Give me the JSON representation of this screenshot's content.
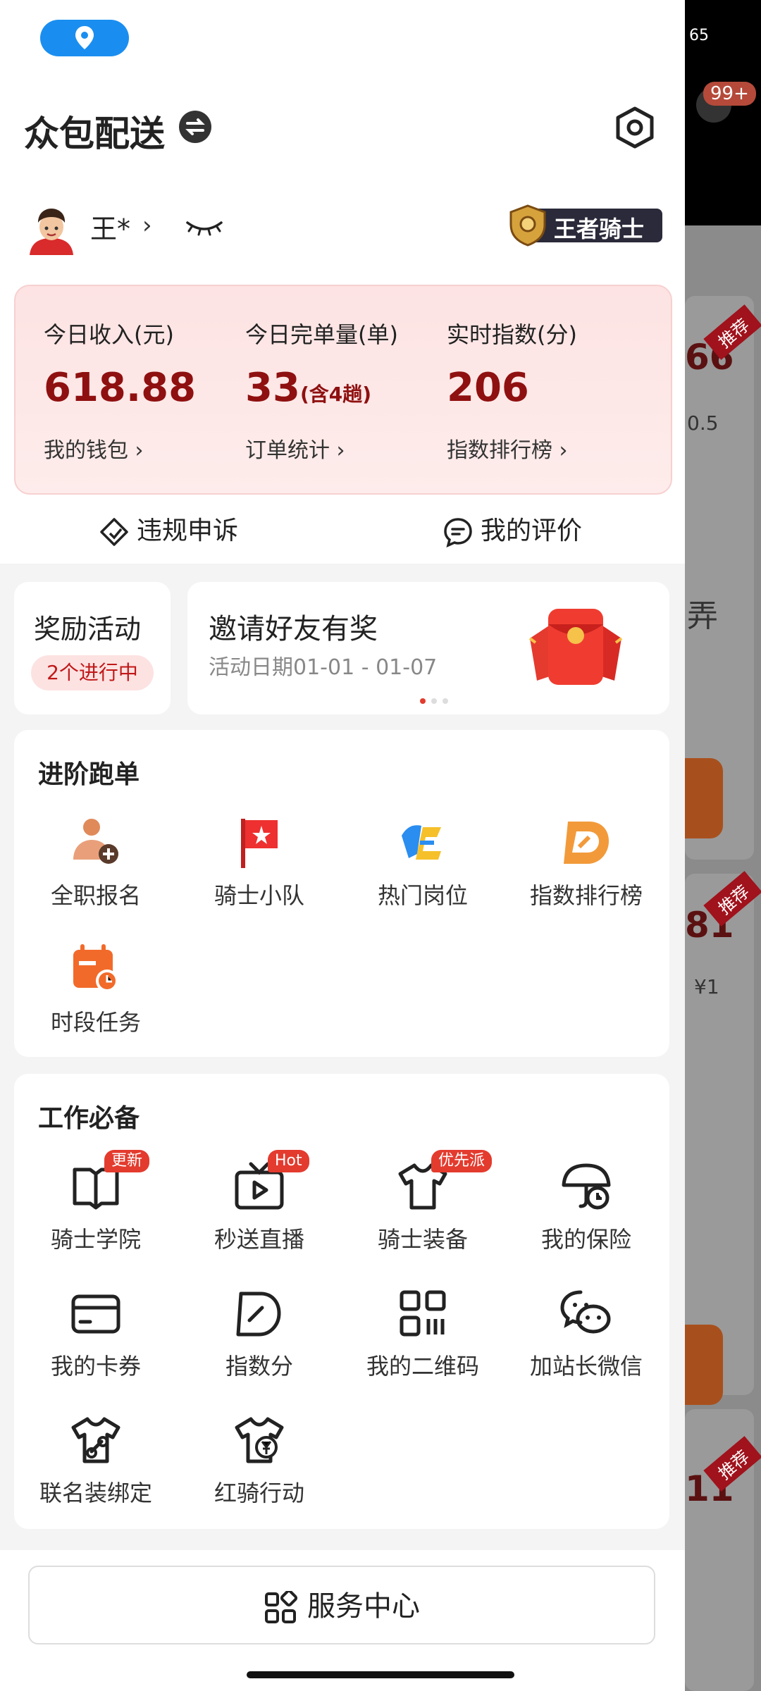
{
  "header": {
    "title": "众包配送",
    "user_name": "王*",
    "rank_label": "王者骑士"
  },
  "stats": [
    {
      "label": "今日收入(元)",
      "value": "618.88",
      "extra": "",
      "link": "我的钱包"
    },
    {
      "label": "今日完单量(单)",
      "value": "33",
      "extra": "(含4趟)",
      "link": "订单统计"
    },
    {
      "label": "实时指数(分)",
      "value": "206",
      "extra": "",
      "link": "指数排行榜"
    }
  ],
  "actions": {
    "appeal": "违规申诉",
    "reviews": "我的评价"
  },
  "reward": {
    "title": "奖励活动",
    "badge": "2个进行中"
  },
  "invite": {
    "title": "邀请好友有奖",
    "date": "活动日期01-01 - 01-07"
  },
  "advanced": {
    "title": "进阶跑单",
    "items": [
      {
        "label": "全职报名",
        "icon": "fulltime-signup-icon"
      },
      {
        "label": "骑士小队",
        "icon": "flag-icon"
      },
      {
        "label": "热门岗位",
        "icon": "hot-jobs-icon"
      },
      {
        "label": "指数排行榜",
        "icon": "index-rank-icon"
      },
      {
        "label": "时段任务",
        "icon": "calendar-clock-icon"
      }
    ]
  },
  "essentials": {
    "title": "工作必备",
    "items": [
      {
        "label": "骑士学院",
        "icon": "book-icon",
        "badge": "更新"
      },
      {
        "label": "秒送直播",
        "icon": "live-tv-icon",
        "badge": "Hot"
      },
      {
        "label": "骑士装备",
        "icon": "tshirt-icon",
        "badge": "优先派"
      },
      {
        "label": "我的保险",
        "icon": "umbrella-clock-icon",
        "badge": ""
      },
      {
        "label": "我的卡券",
        "icon": "card-icon",
        "badge": ""
      },
      {
        "label": "指数分",
        "icon": "index-score-icon",
        "badge": ""
      },
      {
        "label": "我的二维码",
        "icon": "qrcode-icon",
        "badge": ""
      },
      {
        "label": "加站长微信",
        "icon": "wechat-icon",
        "badge": ""
      },
      {
        "label": "联名装绑定",
        "icon": "shirt-link-icon",
        "badge": ""
      },
      {
        "label": "红骑行动",
        "icon": "shirt-yuan-icon",
        "badge": ""
      }
    ]
  },
  "bottom": {
    "service_center": "服务中心"
  },
  "background": {
    "notification_count": "99+",
    "battery": "65",
    "tag": "推荐",
    "nums": [
      "66",
      "81",
      "11"
    ],
    "side_texts": [
      "0.5",
      "¥1",
      "弄"
    ]
  }
}
